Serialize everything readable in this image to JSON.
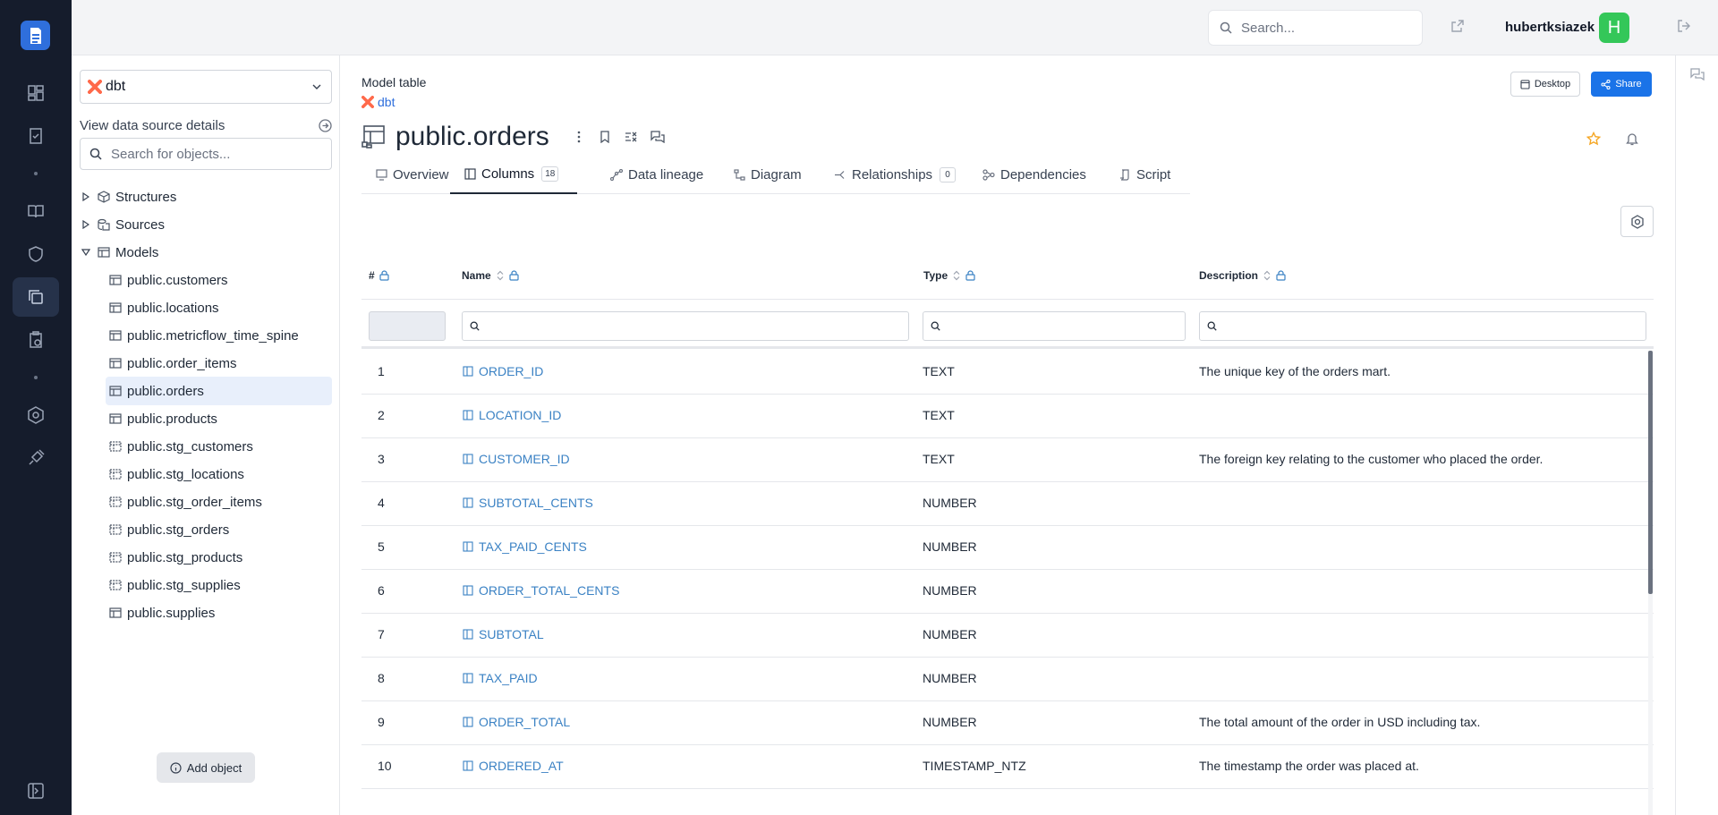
{
  "topbar": {
    "search_placeholder": "Search...",
    "username": "hubertksiazek",
    "avatar_initial": "H"
  },
  "sidebar": {
    "datasource": {
      "name": "dbt",
      "brand_color": "#ff694a"
    },
    "details_link": "View data source details",
    "search_placeholder": "Search for objects...",
    "folders": [
      {
        "label": "Structures",
        "expanded": false
      },
      {
        "label": "Sources",
        "expanded": false
      },
      {
        "label": "Models",
        "expanded": true
      }
    ],
    "models": [
      {
        "label": "public.customers",
        "kind": "table"
      },
      {
        "label": "public.locations",
        "kind": "table"
      },
      {
        "label": "public.metricflow_time_spine",
        "kind": "table"
      },
      {
        "label": "public.order_items",
        "kind": "table"
      },
      {
        "label": "public.orders",
        "kind": "table",
        "selected": true
      },
      {
        "label": "public.products",
        "kind": "table"
      },
      {
        "label": "public.stg_customers",
        "kind": "view"
      },
      {
        "label": "public.stg_locations",
        "kind": "view"
      },
      {
        "label": "public.stg_order_items",
        "kind": "view"
      },
      {
        "label": "public.stg_orders",
        "kind": "view"
      },
      {
        "label": "public.stg_products",
        "kind": "view"
      },
      {
        "label": "public.stg_supplies",
        "kind": "view"
      },
      {
        "label": "public.supplies",
        "kind": "table"
      }
    ],
    "add_object_label": "Add object"
  },
  "header": {
    "object_type": "Model table",
    "source_name": "dbt",
    "title": "public.orders",
    "desktop_label": "Desktop",
    "share_label": "Share"
  },
  "tabs": [
    {
      "label": "Overview",
      "icon": "overview-icon"
    },
    {
      "label": "Columns",
      "icon": "columns-icon",
      "badge": "18",
      "active": true
    },
    {
      "label": "Data lineage",
      "icon": "lineage-icon"
    },
    {
      "label": "Diagram",
      "icon": "diagram-icon"
    },
    {
      "label": "Relationships",
      "icon": "relationships-icon",
      "badge": "0"
    },
    {
      "label": "Dependencies",
      "icon": "dependencies-icon"
    },
    {
      "label": "Script",
      "icon": "script-icon"
    }
  ],
  "table": {
    "headers": {
      "num": "#",
      "name": "Name",
      "type": "Type",
      "description": "Description"
    },
    "rows": [
      {
        "num": "1",
        "name": "ORDER_ID",
        "type": "TEXT",
        "description": "The unique key of the orders mart."
      },
      {
        "num": "2",
        "name": "LOCATION_ID",
        "type": "TEXT",
        "description": ""
      },
      {
        "num": "3",
        "name": "CUSTOMER_ID",
        "type": "TEXT",
        "description": "The foreign key relating to the customer who placed the order."
      },
      {
        "num": "4",
        "name": "SUBTOTAL_CENTS",
        "type": "NUMBER",
        "description": ""
      },
      {
        "num": "5",
        "name": "TAX_PAID_CENTS",
        "type": "NUMBER",
        "description": ""
      },
      {
        "num": "6",
        "name": "ORDER_TOTAL_CENTS",
        "type": "NUMBER",
        "description": ""
      },
      {
        "num": "7",
        "name": "SUBTOTAL",
        "type": "NUMBER",
        "description": ""
      },
      {
        "num": "8",
        "name": "TAX_PAID",
        "type": "NUMBER",
        "description": ""
      },
      {
        "num": "9",
        "name": "ORDER_TOTAL",
        "type": "NUMBER",
        "description": "The total amount of the order in USD including tax."
      },
      {
        "num": "10",
        "name": "ORDERED_AT",
        "type": "TIMESTAMP_NTZ",
        "description": "The timestamp the order was placed at."
      }
    ]
  },
  "colors": {
    "rail_bg": "#151c2c",
    "accent": "#1a73e8",
    "link": "#3b82c4",
    "avatar": "#34c759",
    "star": "#f5a623"
  }
}
